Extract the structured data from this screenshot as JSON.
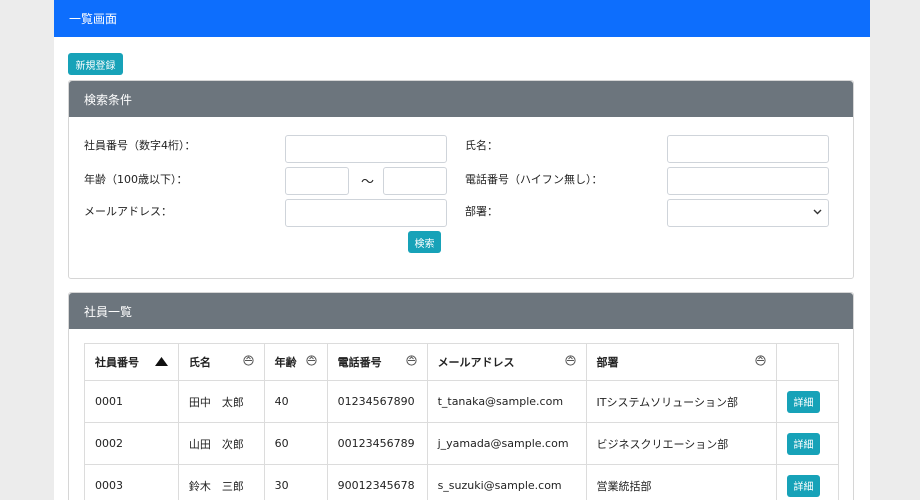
{
  "header": {
    "title": "一覧画面"
  },
  "new_button": "新規登録",
  "search": {
    "title": "検索条件",
    "emp_no_label": "社員番号（数字4桁）：",
    "name_label": "氏名：",
    "age_label": "年齢（100歳以下）：",
    "age_separator": "～",
    "phone_label": "電話番号（ハイフン無し）：",
    "email_label": "メールアドレス：",
    "dept_label": "部署：",
    "emp_no_value": "",
    "name_value": "",
    "age_from_value": "",
    "age_to_value": "",
    "phone_value": "",
    "email_value": "",
    "dept_value": "",
    "search_button": "検索"
  },
  "list": {
    "title": "社員一覧",
    "columns": [
      "社員番号",
      "氏名",
      "年齢",
      "電話番号",
      "メールアドレス",
      "部署",
      ""
    ],
    "rows": [
      {
        "emp_no": "0001",
        "name": "田中　太郎",
        "age": "40",
        "phone": "01234567890",
        "email": "t_tanaka@sample.com",
        "dept": "ITシステムソリューション部",
        "detail": "詳細"
      },
      {
        "emp_no": "0002",
        "name": "山田　次郎",
        "age": "60",
        "phone": "00123456789",
        "email": "j_yamada@sample.com",
        "dept": "ビジネスクリエーション部",
        "detail": "詳細"
      },
      {
        "emp_no": "0003",
        "name": "鈴木　三郎",
        "age": "30",
        "phone": "90012345678",
        "email": "s_suzuki@sample.com",
        "dept": "営業統括部",
        "detail": "詳細"
      }
    ]
  },
  "icons": {
    "sort_asc": "triangle-up-icon",
    "sort_neutral": "sort-circle-icon",
    "select_arrow": "chevron-down-icon"
  },
  "colors": {
    "topbar": "#0d6efd",
    "card_header": "#6c757d",
    "button": "#17a2b8"
  }
}
